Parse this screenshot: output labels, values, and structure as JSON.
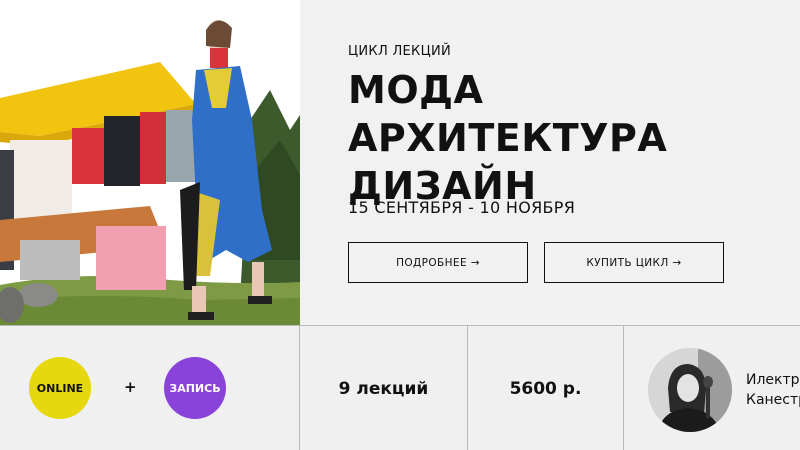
{
  "hero": {
    "eyebrow": "ЦИКЛ ЛЕКЦИЙ",
    "title_line1": "МОДА АРХИТЕКТУРА",
    "title_line2": "ДИЗАЙН",
    "dates": "15 СЕНТЯБРЯ - 10 НОЯБРЯ",
    "more_button": "ПОДРОБНЕЕ →",
    "buy_button": "КУПИТЬ ЦИКЛ →"
  },
  "strip": {
    "format_online": "ONLINE",
    "plus": "+",
    "format_record": "ЗАПИСЬ",
    "lectures": "9 лекций",
    "price": "5600 р.",
    "lecturer_first": "Илектр",
    "lecturer_last": "Канестр"
  },
  "colors": {
    "online_circle": "#e6d80e",
    "record_circle": "#8a43d8",
    "background": "#f1f1f1",
    "border": "#b9b9b9"
  }
}
